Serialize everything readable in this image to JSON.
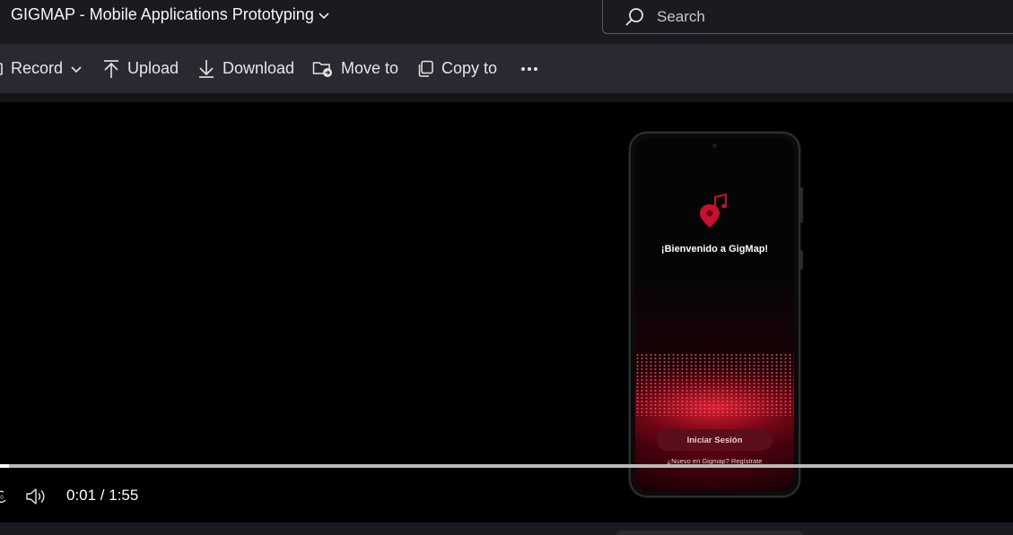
{
  "header": {
    "title": "GIGMAP - Mobile Applications Prototyping",
    "search_placeholder": "Search"
  },
  "toolbar": {
    "record_label": "Record",
    "upload_label": "Upload",
    "download_label": "Download",
    "move_label": "Move to",
    "copy_label": "Copy to",
    "more_label": "···"
  },
  "video": {
    "app_welcome": "¡Bienvenido a GigMap!",
    "login_button": "Iniciar Sesión",
    "register_text": "¿Nuevo en Gigmap? Regístrate",
    "time_display": "0:01 / 1:55",
    "progress_fraction": 0.0087,
    "accent_color": "#c8102e"
  }
}
